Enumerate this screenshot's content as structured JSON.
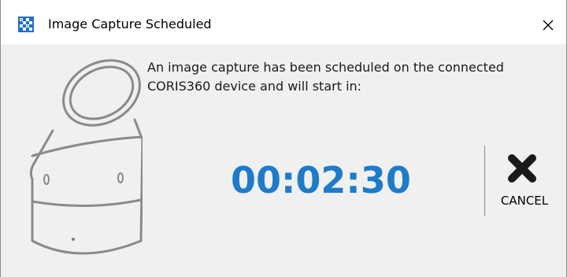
{
  "window": {
    "title": "Image Capture Scheduled",
    "app_icon": "checkered-app-icon",
    "close_icon": "close-icon"
  },
  "dialog": {
    "message": "An image capture has been scheduled on the connected CORIS360 device and will start in:",
    "countdown": "00:02:30",
    "cancel_label": "CANCEL",
    "cancel_icon": "x-mark-icon",
    "device_icon": "coris360-device-illustration"
  },
  "colors": {
    "countdown": "#1e7bc9",
    "background": "#f0f0f0",
    "titlebar": "#ffffff"
  }
}
